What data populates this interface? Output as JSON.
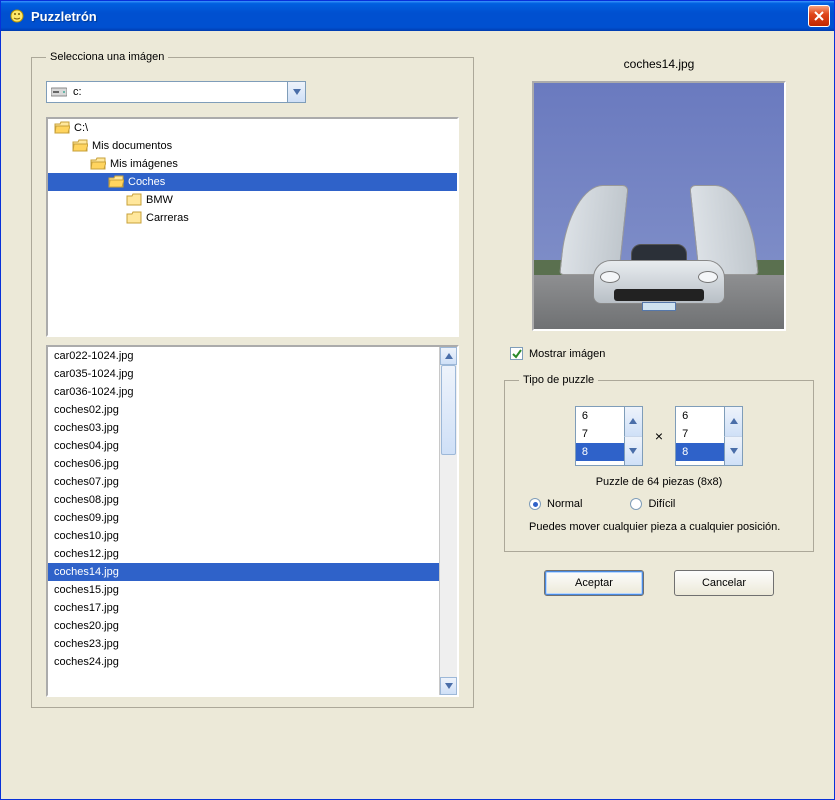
{
  "window": {
    "title": "Puzzletrón"
  },
  "left": {
    "group_label": "Selecciona una imágen",
    "drive": {
      "selected": "c:"
    },
    "tree": [
      {
        "label": "C:\\",
        "indent": 0,
        "selected": false,
        "open": true
      },
      {
        "label": "Mis documentos",
        "indent": 1,
        "selected": false,
        "open": true
      },
      {
        "label": "Mis imágenes",
        "indent": 2,
        "selected": false,
        "open": true
      },
      {
        "label": "Coches",
        "indent": 3,
        "selected": true,
        "open": true
      },
      {
        "label": "BMW",
        "indent": 4,
        "selected": false,
        "open": false
      },
      {
        "label": "Carreras",
        "indent": 4,
        "selected": false,
        "open": false
      }
    ],
    "files": [
      {
        "name": "car022-1024.jpg",
        "selected": false
      },
      {
        "name": "car035-1024.jpg",
        "selected": false
      },
      {
        "name": "car036-1024.jpg",
        "selected": false
      },
      {
        "name": "coches02.jpg",
        "selected": false
      },
      {
        "name": "coches03.jpg",
        "selected": false
      },
      {
        "name": "coches04.jpg",
        "selected": false
      },
      {
        "name": "coches06.jpg",
        "selected": false
      },
      {
        "name": "coches07.jpg",
        "selected": false
      },
      {
        "name": "coches08.jpg",
        "selected": false
      },
      {
        "name": "coches09.jpg",
        "selected": false
      },
      {
        "name": "coches10.jpg",
        "selected": false
      },
      {
        "name": "coches12.jpg",
        "selected": false
      },
      {
        "name": "coches14.jpg",
        "selected": true
      },
      {
        "name": "coches15.jpg",
        "selected": false
      },
      {
        "name": "coches17.jpg",
        "selected": false
      },
      {
        "name": "coches20.jpg",
        "selected": false
      },
      {
        "name": "coches23.jpg",
        "selected": false
      },
      {
        "name": "coches24.jpg",
        "selected": false
      }
    ]
  },
  "preview": {
    "filename": "coches14.jpg",
    "show_checkbox_label": "Mostrar imágen",
    "show_checked": true
  },
  "puzzle": {
    "group_label": "Tipo de puzzle",
    "cols_options": [
      "6",
      "7",
      "8"
    ],
    "cols_selected": "8",
    "rows_options": [
      "6",
      "7",
      "8"
    ],
    "rows_selected": "8",
    "multiply_symbol": "×",
    "pieces_label": "Puzzle de 64 piezas (8x8)",
    "radio_normal": "Normal",
    "radio_dificil": "Difícil",
    "mode_selected": "normal",
    "help_text": "Puedes mover cualquier pieza a cualquier posición."
  },
  "buttons": {
    "accept": "Aceptar",
    "cancel": "Cancelar"
  }
}
